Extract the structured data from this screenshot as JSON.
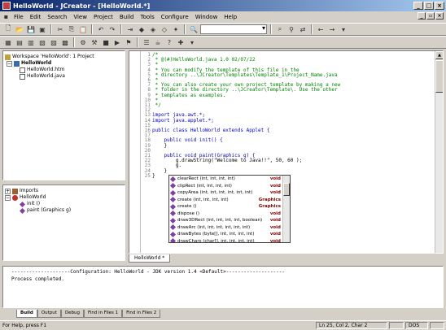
{
  "window": {
    "title": "HelloWorld - JCreator - [HelloWorld.*]"
  },
  "menu": [
    "File",
    "Edit",
    "Search",
    "View",
    "Project",
    "Build",
    "Tools",
    "Configure",
    "Window",
    "Help"
  ],
  "workspace": {
    "root": "Workspace 'HelloWorld': 1 Project",
    "project": "HelloWorld",
    "files": [
      "HelloWorld.htm",
      "HelloWorld.java"
    ]
  },
  "fileview": {
    "imports": "Imports",
    "class": "HelloWorld",
    "methods": [
      "init ()",
      "paint (Graphics g)"
    ]
  },
  "code_lines": [
    {
      "n": "1",
      "t": "/*",
      "k": "cm"
    },
    {
      "n": "2",
      "t": " * @(#)HelloWorld.java 1.0 02/07/22",
      "k": "cm"
    },
    {
      "n": "3",
      "t": " *",
      "k": "cm"
    },
    {
      "n": "4",
      "t": " * You can modify the template of this file in the",
      "k": "cm"
    },
    {
      "n": "5",
      "t": " * directory ..\\JCreator\\Templates\\Template_1\\Project_Name.java",
      "k": "cm"
    },
    {
      "n": "6",
      "t": " *",
      "k": "cm"
    },
    {
      "n": "7",
      "t": " * You can also create your own project template by making a new",
      "k": "cm"
    },
    {
      "n": "8",
      "t": " * folder in the directory ..\\JCreator\\Template\\. Use the other",
      "k": "cm"
    },
    {
      "n": "9",
      "t": " * templates as examples.",
      "k": "cm"
    },
    {
      "n": "10",
      "t": " *",
      "k": "cm"
    },
    {
      "n": "11",
      "t": " */",
      "k": "cm"
    },
    {
      "n": "12",
      "t": "",
      "k": ""
    },
    {
      "n": "13",
      "t": "import java.awt.*;",
      "k": "kw"
    },
    {
      "n": "14",
      "t": "import java.applet.*;",
      "k": "kw"
    },
    {
      "n": "15",
      "t": "",
      "k": ""
    },
    {
      "n": "16",
      "t": "public class HelloWorld extends Applet {",
      "k": "kw"
    },
    {
      "n": "17",
      "t": "",
      "k": ""
    },
    {
      "n": "18",
      "t": "    public void init() {",
      "k": "kw"
    },
    {
      "n": "19",
      "t": "    }",
      "k": ""
    },
    {
      "n": "20",
      "t": "",
      "k": ""
    },
    {
      "n": "21",
      "t": "    public void paint(Graphics g) {",
      "k": "kw"
    },
    {
      "n": "22",
      "t": "        g.drawString(\"Welcome to Java!!\", 50, 60 );",
      "k": ""
    },
    {
      "n": "23",
      "t": "        g.",
      "k": ""
    },
    {
      "n": "24",
      "t": "    }",
      "k": ""
    },
    {
      "n": "25",
      "t": "}",
      "k": ""
    }
  ],
  "completion": [
    {
      "name": "clearRect (int, int, int, int)",
      "ret": "void"
    },
    {
      "name": "clipRect (int, int, int, int)",
      "ret": "void"
    },
    {
      "name": "copyArea (int, int, int, int, int, int)",
      "ret": "void"
    },
    {
      "name": "create (int, int, int, int)",
      "ret": "Graphics"
    },
    {
      "name": "create ()",
      "ret": "Graphics"
    },
    {
      "name": "dispose ()",
      "ret": "void"
    },
    {
      "name": "draw3DRect (int, int, int, int, boolean)",
      "ret": "void"
    },
    {
      "name": "drawArc (int, int, int, int, int, int)",
      "ret": "void"
    },
    {
      "name": "drawBytes (byte[], int, int, int, int)",
      "ret": "void"
    },
    {
      "name": "drawChars (char[], int, int, int, int)",
      "ret": "void"
    }
  ],
  "doc_tab": "HelloWorld *",
  "output": {
    "line1": "--------------------Configuration: HelloWorld - JDK version 1.4 <Default>--------------------",
    "line2": "",
    "line3": "Process completed."
  },
  "output_tabs": [
    "Build",
    "Output",
    "Debug",
    "Find in Files 1",
    "Find in Files 2"
  ],
  "status": {
    "help": "For Help, press F1",
    "position": "Ln 25, Col 2, Char 2",
    "mode": "DOS"
  }
}
